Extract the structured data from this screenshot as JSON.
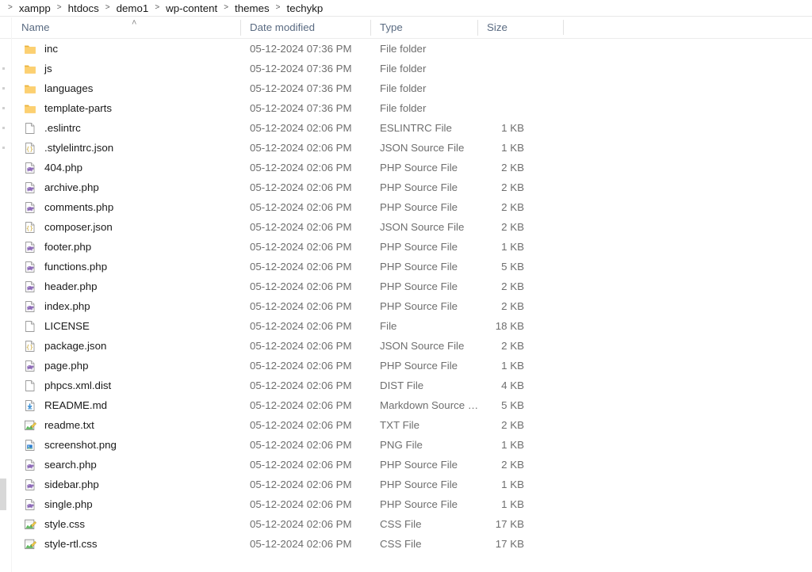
{
  "window": {
    "type": "file-explorer",
    "background": "#ffffff"
  },
  "breadcrumb": {
    "separator": ">",
    "items": [
      "xampp",
      "htdocs",
      "demo1",
      "wp-content",
      "themes",
      "techykp"
    ]
  },
  "columns": {
    "name": "Name",
    "date_modified": "Date modified",
    "type": "Type",
    "size": "Size",
    "sort_column": "Name",
    "sort_direction": "ascending",
    "sort_glyph": "˄"
  },
  "colors": {
    "folder": "#ffc societ",
    "folder_fill": "#f8c253",
    "php_accent": "#8d6ab8",
    "json_accent": "#c9a227",
    "md_accent": "#3b8fd4",
    "img_accent": "#2f7fd0",
    "css_accent": "#4caf50",
    "header_text": "#5a6b82",
    "body_text": "#1a1a1a",
    "secondary_text": "#6e6e6e"
  },
  "files": [
    {
      "name": "inc",
      "icon": "folder-icon",
      "date": "05-12-2024 07:36 PM",
      "type": "File folder",
      "size": ""
    },
    {
      "name": "js",
      "icon": "folder-icon",
      "date": "05-12-2024 07:36 PM",
      "type": "File folder",
      "size": ""
    },
    {
      "name": "languages",
      "icon": "folder-icon",
      "date": "05-12-2024 07:36 PM",
      "type": "File folder",
      "size": ""
    },
    {
      "name": "template-parts",
      "icon": "folder-icon",
      "date": "05-12-2024 07:36 PM",
      "type": "File folder",
      "size": ""
    },
    {
      "name": ".eslintrc",
      "icon": "blank-file-icon",
      "date": "05-12-2024 02:06 PM",
      "type": "ESLINTRC File",
      "size": "1 KB"
    },
    {
      "name": ".stylelintrc.json",
      "icon": "json-file-icon",
      "date": "05-12-2024 02:06 PM",
      "type": "JSON Source File",
      "size": "1 KB"
    },
    {
      "name": "404.php",
      "icon": "php-file-icon",
      "date": "05-12-2024 02:06 PM",
      "type": "PHP Source File",
      "size": "2 KB"
    },
    {
      "name": "archive.php",
      "icon": "php-file-icon",
      "date": "05-12-2024 02:06 PM",
      "type": "PHP Source File",
      "size": "2 KB"
    },
    {
      "name": "comments.php",
      "icon": "php-file-icon",
      "date": "05-12-2024 02:06 PM",
      "type": "PHP Source File",
      "size": "2 KB"
    },
    {
      "name": "composer.json",
      "icon": "json-file-icon",
      "date": "05-12-2024 02:06 PM",
      "type": "JSON Source File",
      "size": "2 KB"
    },
    {
      "name": "footer.php",
      "icon": "php-file-icon",
      "date": "05-12-2024 02:06 PM",
      "type": "PHP Source File",
      "size": "1 KB"
    },
    {
      "name": "functions.php",
      "icon": "php-file-icon",
      "date": "05-12-2024 02:06 PM",
      "type": "PHP Source File",
      "size": "5 KB"
    },
    {
      "name": "header.php",
      "icon": "php-file-icon",
      "date": "05-12-2024 02:06 PM",
      "type": "PHP Source File",
      "size": "2 KB"
    },
    {
      "name": "index.php",
      "icon": "php-file-icon",
      "date": "05-12-2024 02:06 PM",
      "type": "PHP Source File",
      "size": "2 KB"
    },
    {
      "name": "LICENSE",
      "icon": "blank-file-icon",
      "date": "05-12-2024 02:06 PM",
      "type": "File",
      "size": "18 KB"
    },
    {
      "name": "package.json",
      "icon": "json-file-icon",
      "date": "05-12-2024 02:06 PM",
      "type": "JSON Source File",
      "size": "2 KB"
    },
    {
      "name": "page.php",
      "icon": "php-file-icon",
      "date": "05-12-2024 02:06 PM",
      "type": "PHP Source File",
      "size": "1 KB"
    },
    {
      "name": "phpcs.xml.dist",
      "icon": "blank-file-icon",
      "date": "05-12-2024 02:06 PM",
      "type": "DIST File",
      "size": "4 KB"
    },
    {
      "name": "README.md",
      "icon": "markdown-file-icon",
      "date": "05-12-2024 02:06 PM",
      "type": "Markdown Source …",
      "size": "5 KB"
    },
    {
      "name": "readme.txt",
      "icon": "chart-file-icon",
      "date": "05-12-2024 02:06 PM",
      "type": "TXT File",
      "size": "2 KB"
    },
    {
      "name": "screenshot.png",
      "icon": "image-file-icon",
      "date": "05-12-2024 02:06 PM",
      "type": "PNG File",
      "size": "1 KB"
    },
    {
      "name": "search.php",
      "icon": "php-file-icon",
      "date": "05-12-2024 02:06 PM",
      "type": "PHP Source File",
      "size": "2 KB"
    },
    {
      "name": "sidebar.php",
      "icon": "php-file-icon",
      "date": "05-12-2024 02:06 PM",
      "type": "PHP Source File",
      "size": "1 KB"
    },
    {
      "name": "single.php",
      "icon": "php-file-icon",
      "date": "05-12-2024 02:06 PM",
      "type": "PHP Source File",
      "size": "1 KB"
    },
    {
      "name": "style.css",
      "icon": "chart-file-icon",
      "date": "05-12-2024 02:06 PM",
      "type": "CSS File",
      "size": "17 KB"
    },
    {
      "name": "style-rtl.css",
      "icon": "chart-file-icon",
      "date": "05-12-2024 02:06 PM",
      "type": "CSS File",
      "size": "17 KB"
    }
  ]
}
